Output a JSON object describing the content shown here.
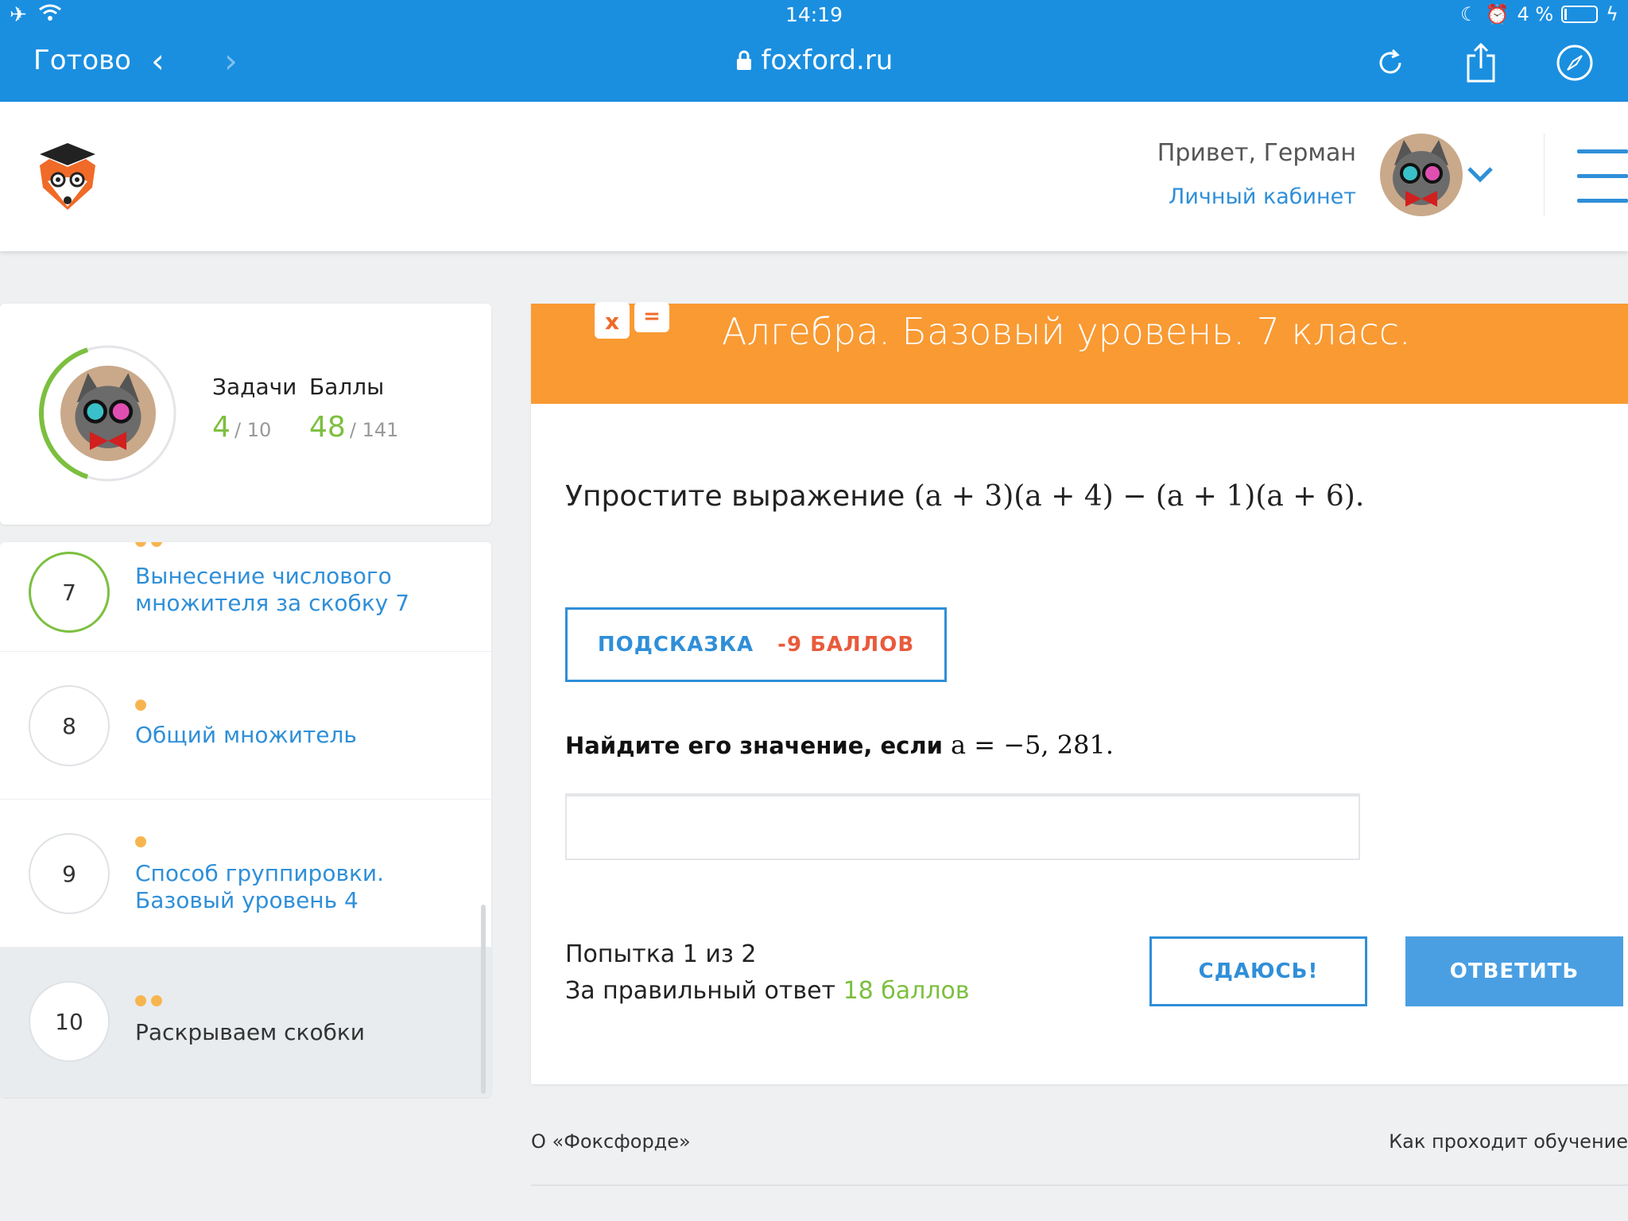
{
  "status_bar": {
    "time": "14:19",
    "battery": "4 %"
  },
  "browser": {
    "done_label": "Готово",
    "url": "foxford.ru"
  },
  "header": {
    "greeting": "Привет, Герман",
    "cabinet_link": "Личный кабинет"
  },
  "profile": {
    "tasks_label": "Задачи",
    "tasks_done": "4",
    "tasks_total": "/ 10",
    "points_label": "Баллы",
    "points_done": "48",
    "points_total": "/ 141",
    "progress_fraction": 0.4
  },
  "lessons": [
    {
      "number": "7",
      "title": "Вынесение числового множителя за скобку 7",
      "dots": 2,
      "completed": true
    },
    {
      "number": "8",
      "title": "Общий множитель",
      "dots": 1,
      "completed": false
    },
    {
      "number": "9",
      "title": "Способ группировки. Базовый уровень 4",
      "dots": 1,
      "completed": false
    },
    {
      "number": "10",
      "title": "Раскрываем скобки",
      "dots": 2,
      "completed": false,
      "active": true
    }
  ],
  "task": {
    "course_title": "Алгебра. Базовый уровень. 7 класс.",
    "course_icon_left": "x",
    "course_icon_right": "=",
    "prompt": "Упростите выражение",
    "expression": "(a + 3)(a + 4) − (a + 1)(a + 6).",
    "hint_label": "ПОДСКАЗКА",
    "hint_cost": "-9 БАЛЛОВ",
    "find_prompt": "Найдите его значение, если",
    "find_condition": "a = −5, 281.",
    "answer_value": "",
    "attempt_text": "Попытка 1 из 2",
    "reward_prefix": "За правильный ответ",
    "reward_points": "18 баллов",
    "giveup_label": "СДАЮСЬ!",
    "answer_label": "ОТВЕТИТЬ"
  },
  "footer": {
    "about": "О «Фоксфорде»",
    "how": "Как проходит обучение"
  },
  "colors": {
    "primary": "#2f8fd8",
    "accent": "#f99a33",
    "success": "#7cbf3f",
    "danger": "#e85b3c",
    "browser_bar": "#1a8fe0"
  }
}
